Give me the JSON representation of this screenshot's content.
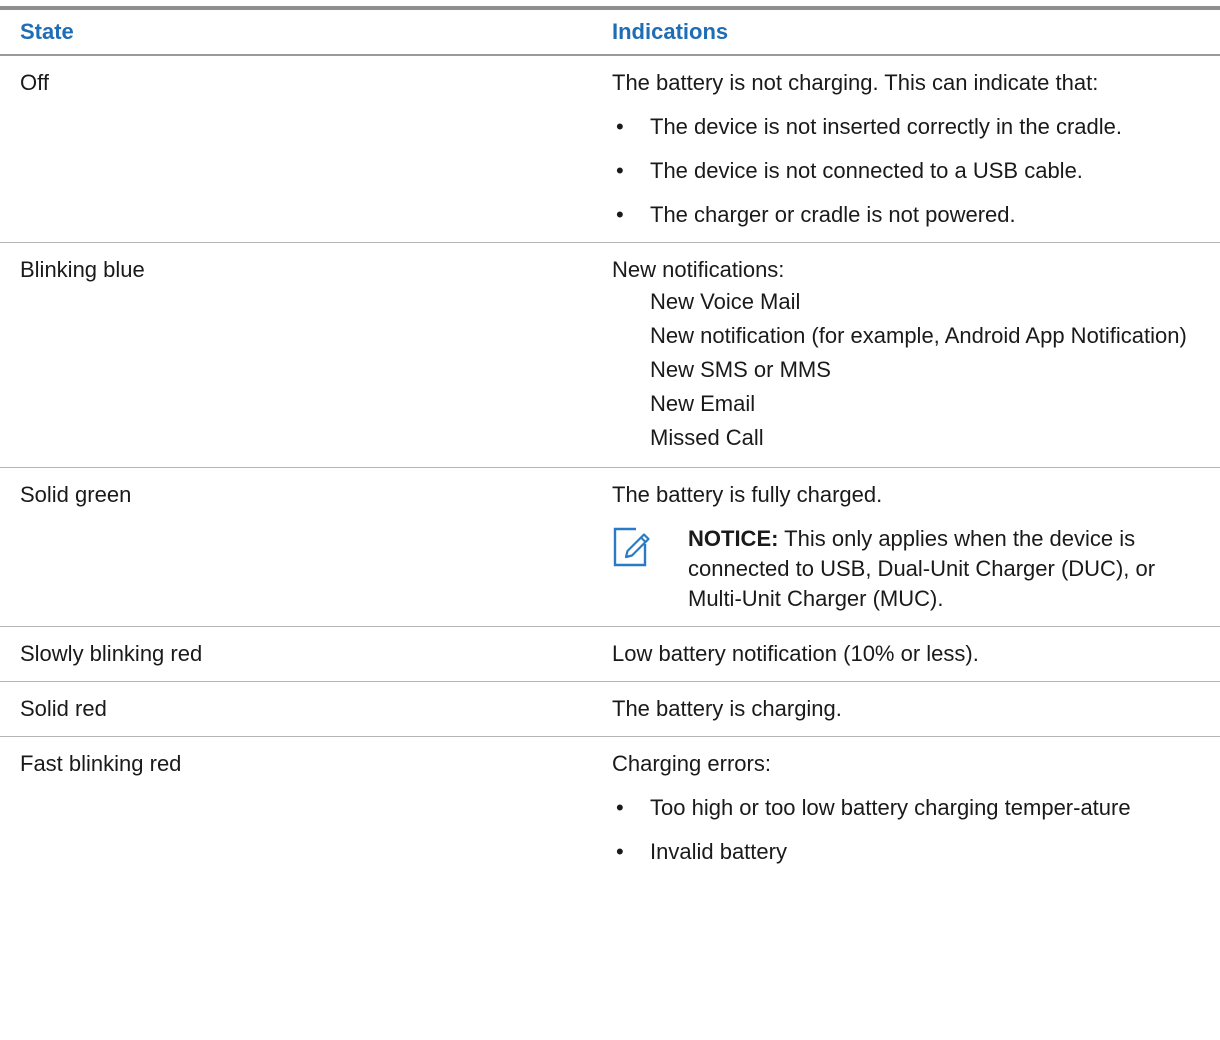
{
  "header": {
    "state": "State",
    "indications": "Indications"
  },
  "rows": [
    {
      "state": "Off",
      "intro": "The battery is not charging. This can indicate that:",
      "bullets": [
        "The device is not inserted correctly in the cradle.",
        "The device is not connected to a USB cable.",
        "The charger or cradle is not powered."
      ]
    },
    {
      "state": "Blinking blue",
      "intro": "New notifications:",
      "subitems": [
        "New Voice Mail",
        "New notification (for example, Android App Notification)",
        "New SMS or MMS",
        "New Email",
        "Missed Call"
      ]
    },
    {
      "state": "Solid green",
      "intro": "The battery is fully charged.",
      "notice_label": "NOTICE:",
      "notice_text": " This only applies when the device is connected to USB, Dual-Unit Charger (DUC), or Multi-Unit Charger (MUC)."
    },
    {
      "state": "Slowly blinking red",
      "intro": "Low battery notification (10% or less)."
    },
    {
      "state": "Solid red",
      "intro": "The battery is charging."
    },
    {
      "state": "Fast blinking red",
      "intro": "Charging errors:",
      "bullets": [
        "Too high or too low battery charging temper-ature",
        "Invalid battery"
      ]
    }
  ],
  "bullet_glyph": "•",
  "icons": {
    "notice": "pencil-note-icon"
  },
  "colors": {
    "header_text": "#1f6db5",
    "notice_icon": "#2a7bc4"
  }
}
